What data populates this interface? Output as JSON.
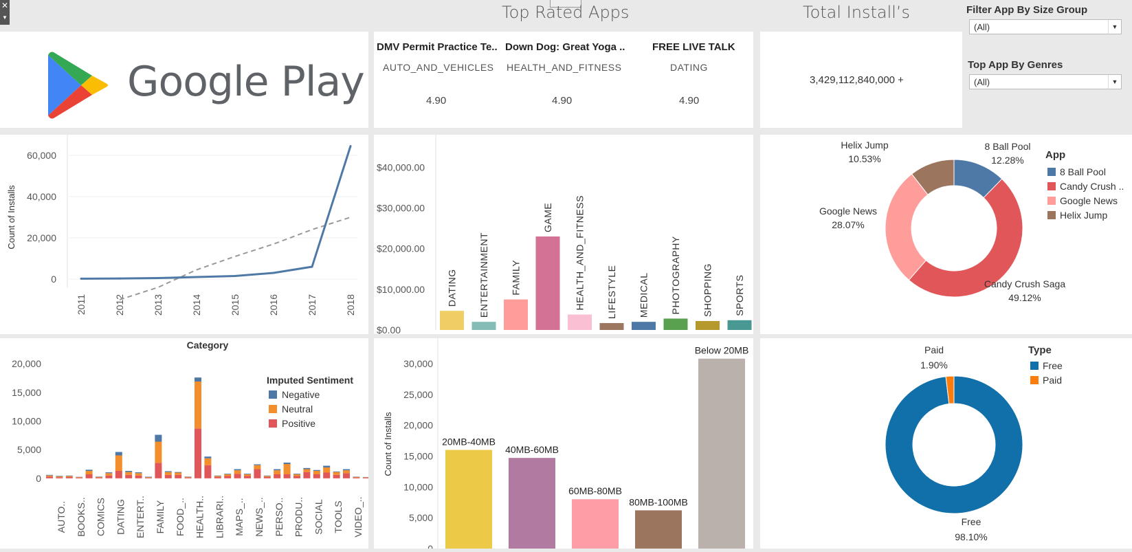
{
  "headers": {
    "top_rated": "Top Rated Apps",
    "total_installs": "Total Install’s"
  },
  "filters": {
    "size_label": "Filter App By Size Group",
    "size_value": "(All)",
    "genre_label": "Top App By Genres",
    "genre_value": "(All)"
  },
  "logo": {
    "text": "Google Play"
  },
  "top_apps": [
    {
      "name": "DMV Permit Practice Te..",
      "category": "AUTO_AND_VEHICLES",
      "rating": "4.90"
    },
    {
      "name": "Down Dog: Great Yoga ..",
      "category": "HEALTH_AND_FITNESS",
      "rating": "4.90"
    },
    {
      "name": "FREE LIVE TALK",
      "category": "DATING",
      "rating": "4.90"
    }
  ],
  "total_installs": "3,429,112,840,000 +",
  "colors": {
    "blue": "#4e79a7",
    "free": "#1170aa",
    "paid": "#fc7d0b"
  },
  "chart_data": [
    {
      "type": "line",
      "ylabel": "Count of Installs",
      "x": [
        "2011",
        "2012",
        "2013",
        "2014",
        "2015",
        "2016",
        "2017",
        "2018"
      ],
      "values": [
        200,
        300,
        500,
        1000,
        1500,
        3000,
        6000,
        64500
      ],
      "trend": [
        -10000,
        -4000,
        4500,
        11000,
        17000,
        24000,
        30000
      ],
      "ylim": [
        -4000,
        66000
      ],
      "yticks": [
        "0",
        "20,000",
        "40,000",
        "60,000"
      ],
      "ytick_values": [
        0,
        20000,
        40000,
        60000
      ]
    },
    {
      "type": "bar",
      "categories": [
        "DATING",
        "ENTERTAINMENT",
        "FAMILY",
        "GAME",
        "HEALTH_AND_FITNESS",
        "LIFESTYLE",
        "MEDICAL",
        "PHOTOGRAPHY",
        "SHOPPING",
        "SPORTS"
      ],
      "values": [
        4700,
        2000,
        7500,
        23000,
        3800,
        1700,
        2000,
        2800,
        2200,
        2400
      ],
      "colors": [
        "#f1ce63",
        "#86bcb6",
        "#ff9d9a",
        "#d37295",
        "#fabfd2",
        "#9d7660",
        "#4e79a7",
        "#59a14f",
        "#b6992d",
        "#499894"
      ],
      "ylim": [
        0,
        46000
      ],
      "yticks": [
        "$0.00",
        "$10,000.00",
        "$20,000.00",
        "$30,000.00",
        "$40,000.00"
      ],
      "ytick_values": [
        0,
        10000,
        20000,
        30000,
        40000
      ]
    },
    {
      "type": "pie",
      "legend_title": "App",
      "legend": [
        "8 Ball Pool",
        "Candy Crush ..",
        "Google News",
        "Helix Jump"
      ],
      "slices": [
        {
          "label": "8 Ball Pool",
          "pct_label": "12.28%",
          "value": 12.28,
          "color": "#4e79a7"
        },
        {
          "label": "Candy Crush Saga",
          "pct_label": "49.12%",
          "value": 49.12,
          "color": "#e15759"
        },
        {
          "label": "Google News",
          "pct_label": "28.07%",
          "value": 28.07,
          "color": "#ff9d9a"
        },
        {
          "label": "Helix Jump",
          "pct_label": "10.53%",
          "value": 10.53,
          "color": "#9c755f"
        }
      ]
    },
    {
      "type": "bar",
      "title": "Category",
      "legend_title": "Imputed Sentiment",
      "series_names": [
        "Negative",
        "Neutral",
        "Positive"
      ],
      "series_colors": [
        "#4e79a7",
        "#f28e2b",
        "#e15759"
      ],
      "labels": [
        "AUTO..",
        "BOOKS..",
        "COMICS",
        "DATING",
        "ENTERT..",
        "FAMILY",
        "FOOD_..",
        "HEALTH..",
        "LIBRARI..",
        "MAPS_..",
        "NEWS_..",
        "PERSO..",
        "PRODU..",
        "SOCIAL",
        "TOOLS",
        "VIDEO_.."
      ],
      "stacks": [
        [
          100,
          200,
          300
        ],
        [
          80,
          150,
          200
        ],
        [
          80,
          150,
          250
        ],
        [
          60,
          100,
          100
        ],
        [
          200,
          600,
          700
        ],
        [
          60,
          100,
          150
        ],
        [
          150,
          400,
          500
        ],
        [
          600,
          2700,
          1300
        ],
        [
          200,
          500,
          600
        ],
        [
          150,
          400,
          500
        ],
        [
          80,
          100,
          100
        ],
        [
          1200,
          3700,
          2700
        ],
        [
          150,
          500,
          600
        ],
        [
          100,
          400,
          600
        ],
        [
          60,
          100,
          150
        ],
        [
          700,
          8200,
          8700
        ],
        [
          300,
          1200,
          2300
        ],
        [
          80,
          150,
          250
        ],
        [
          100,
          300,
          400
        ],
        [
          200,
          600,
          800
        ],
        [
          100,
          300,
          400
        ],
        [
          150,
          700,
          1600
        ],
        [
          80,
          150,
          250
        ],
        [
          200,
          700,
          700
        ],
        [
          250,
          1800,
          700
        ],
        [
          100,
          300,
          400
        ],
        [
          200,
          500,
          1100
        ],
        [
          150,
          600,
          700
        ],
        [
          300,
          900,
          1000
        ],
        [
          100,
          500,
          600
        ],
        [
          200,
          500,
          900
        ],
        [
          50,
          100,
          150
        ],
        [
          50,
          80,
          100
        ]
      ],
      "ylim": [
        -500,
        23500
      ],
      "yticks": [
        "0",
        "5,000",
        "10,000",
        "15,000",
        "20,000"
      ],
      "ytick_values": [
        0,
        5000,
        10000,
        15000,
        20000
      ]
    },
    {
      "type": "bar",
      "ylabel": "Count of Installs",
      "categories": [
        "20MB-40MB",
        "40MB-60MB",
        "60MB-80MB",
        "80MB-100MB",
        "Below 20MB"
      ],
      "values": [
        16000,
        14700,
        8000,
        6200,
        30800
      ],
      "colors": [
        "#edc948",
        "#b07aa1",
        "#ff9da7",
        "#9c755f",
        "#bab0ac"
      ],
      "ylim": [
        0,
        33000
      ],
      "yticks": [
        "0",
        "5,000",
        "10,000",
        "15,000",
        "20,000",
        "25,000",
        "30,000"
      ],
      "ytick_values": [
        0,
        5000,
        10000,
        15000,
        20000,
        25000,
        30000
      ]
    },
    {
      "type": "pie",
      "legend_title": "Type",
      "legend": [
        "Free",
        "Paid"
      ],
      "slices": [
        {
          "label": "Free",
          "pct_label": "98.10%",
          "value": 98.1,
          "color": "#1170aa"
        },
        {
          "label": "Paid",
          "pct_label": "1.90%",
          "value": 1.9,
          "color": "#fc7d0b"
        }
      ]
    }
  ]
}
